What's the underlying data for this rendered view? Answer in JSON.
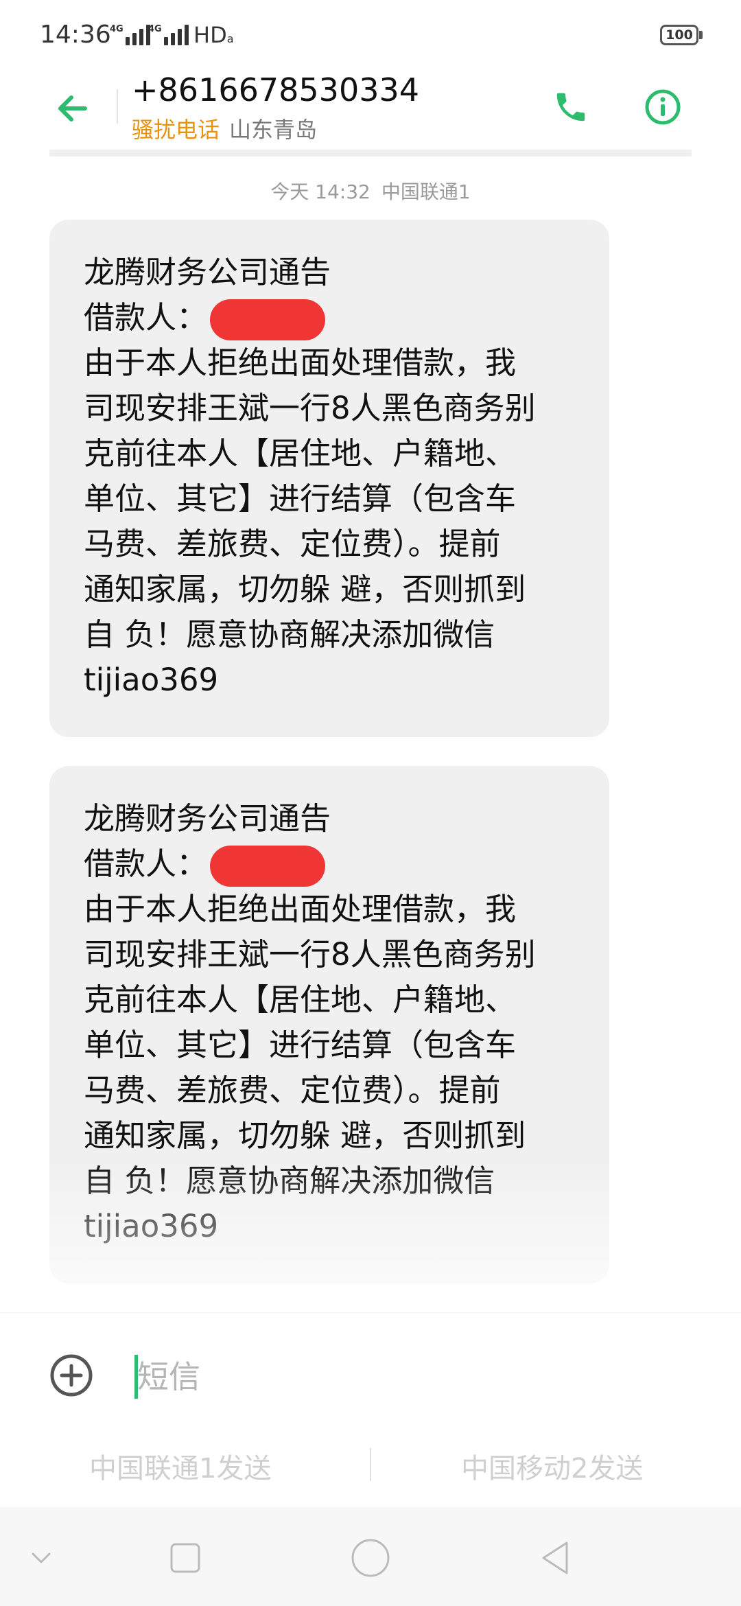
{
  "status_bar": {
    "time": "14:36",
    "sim1_label": "4G",
    "sim2_label": "4G",
    "hd_label": "HD",
    "hd_sub": "a",
    "battery": "100"
  },
  "header": {
    "contact_number": "+8616678530334",
    "spam_tag": "骚扰电话",
    "location": "山东青岛",
    "icons": {
      "back": "arrow-left-icon",
      "call": "phone-icon",
      "info": "info-icon"
    },
    "accent_color": "#2dbb6d"
  },
  "conversation": {
    "timestamp": "今天 14:32",
    "carrier": "中国联通1",
    "messages": [
      {
        "lines": [
          "龙腾财务公司通告",
          "借款人：",
          "由于本人拒绝出面处理借款，我",
          "司现安排王斌一行8人黑色商务别",
          "克前往本人【居住地、户籍地、",
          "单位、其它】进行结算（包含车",
          "马费、差旅费、定位费）。提前",
          "通知家属，切勿躲 避，否则抓到",
          "自 负！愿意协商解决添加微信",
          "tijiao369"
        ]
      },
      {
        "lines": [
          "龙腾财务公司通告",
          "借款人：",
          "由于本人拒绝出面处理借款，我",
          "司现安排王斌一行8人黑色商务别",
          "克前往本人【居住地、户籍地、",
          "单位、其它】进行结算（包含车",
          "马费、差旅费、定位费）。提前",
          "通知家属，切勿躲 避，否则抓到",
          "自 负！愿意协商解决添加微信",
          "tijiao369"
        ]
      }
    ],
    "redaction_color": "#f03535"
  },
  "composer": {
    "placeholder": "短信",
    "value": "",
    "icons": {
      "add": "plus-circle-icon"
    }
  },
  "send_options": {
    "sim1": "中国联通1发送",
    "sim2": "中国移动2发送"
  },
  "nav_bar": {
    "icons": [
      "chevron-down-icon",
      "square-icon",
      "circle-icon",
      "triangle-back-icon"
    ]
  }
}
